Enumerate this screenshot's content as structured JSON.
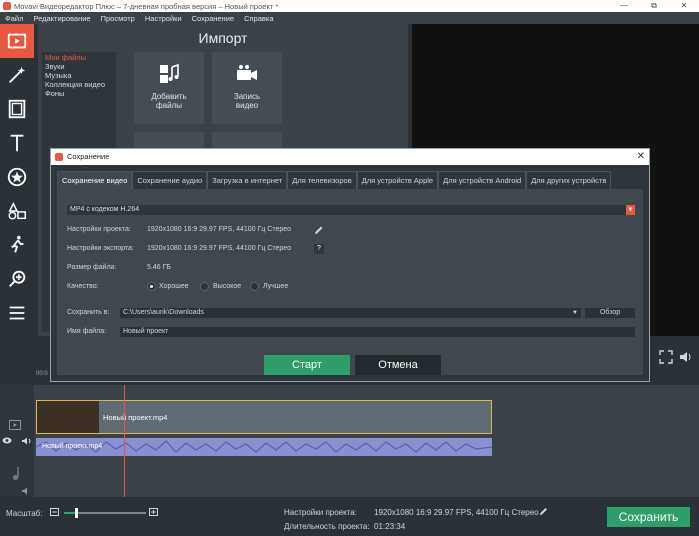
{
  "window": {
    "title": "Movavi Видеоредактор Плюс – 7-дневная пробная версия – Новый проект *",
    "controls": [
      "—",
      "⧉",
      "✕"
    ]
  },
  "menu": [
    "Файл",
    "Редактирование",
    "Просмотр",
    "Настройки",
    "Сохранение",
    "Справка"
  ],
  "import": {
    "title": "Импорт",
    "categories": [
      "Мои файлы",
      "Звуки",
      "Музыка",
      "Коллекция видео",
      "Фоны"
    ],
    "active_category": 0,
    "tiles": [
      "Добавить файлы",
      "Запись видео"
    ]
  },
  "timeline": {
    "ruler_start": "00:0",
    "video_clip": "Новый проект.mp4",
    "audio_clip": "Новый проект.mp4"
  },
  "bottom": {
    "zoom_label": "Масштаб:",
    "zoom_level": 0.15,
    "project_settings_label": "Настройки проекта:",
    "project_settings_value": "1920x1080 16:9 29.97 FPS, 44100 Гц Стерео",
    "duration_label": "Длительность проекта:",
    "duration_value": "01:23:34",
    "save_button": "Сохранить"
  },
  "dialog": {
    "title": "Сохранение",
    "close": "✕",
    "tabs": [
      "Сохранение видео",
      "Сохранение аудио",
      "Загрузка в интернет",
      "Для телевизоров",
      "Для устройств Apple",
      "Для устройств Android",
      "Для других устройств"
    ],
    "active_tab": 0,
    "format": "MP4 с кодеком H.264",
    "project_settings_label": "Настройки проекта:",
    "project_settings_value": "1920x1080 16:9 29.97 FPS, 44100 Гц Стерео",
    "export_settings_label": "Настройки экспорта:",
    "export_settings_value": "1920x1080 16:9 29.97 FPS, 44100 Гц Стерео",
    "file_size_label": "Размер файла:",
    "file_size_value": "5.46 ГБ",
    "quality_label": "Качество:",
    "quality_options": [
      "Хорошее",
      "Высокое",
      "Лучшее"
    ],
    "quality_selected": 0,
    "save_to_label": "Сохранить в:",
    "save_to_value": "C:\\Users\\aurik\\Downloads",
    "browse_button": "Обзор",
    "filename_label": "Имя файла:",
    "filename_value": "Новый проект",
    "help_button": "?",
    "start_button": "Старт",
    "cancel_button": "Отмена"
  }
}
